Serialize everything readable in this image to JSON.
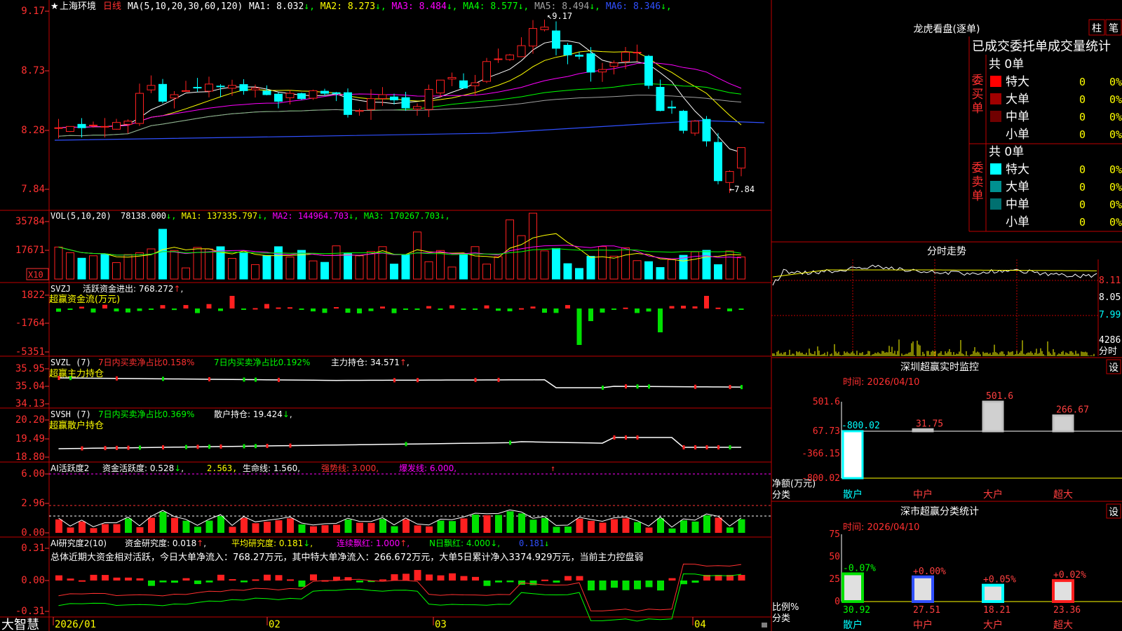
{
  "colors": {
    "up": "#ff2020",
    "down": "#00ffff",
    "green": "#00e000",
    "yellow": "#ffff00",
    "magenta": "#ff00ff",
    "white": "#ffffff",
    "blue": "#3050ff",
    "grid_red": "#c00000",
    "axis_red": "#ff3030",
    "gray": "#a0a0a0"
  },
  "footer": {
    "brand": "大智慧",
    "dates": [
      "2026/01",
      "02",
      "03",
      "04"
    ]
  },
  "kline": {
    "star": "★",
    "name": "上海环境",
    "period": "日线",
    "ma_header": "MA(5,10,20,30,60,120)",
    "ma_items": [
      {
        "label": "MA1:",
        "value": "8.032",
        "color": "#ffffff"
      },
      {
        "label": "MA2:",
        "value": "8.273",
        "color": "#ffff00"
      },
      {
        "label": "MA3:",
        "value": "8.484",
        "color": "#ff00ff"
      },
      {
        "label": "MA4:",
        "value": "8.577",
        "color": "#00ff00"
      },
      {
        "label": "MA5:",
        "value": "8.494",
        "color": "#a0a0a0"
      },
      {
        "label": "MA6:",
        "value": "8.346",
        "color": "#3050ff"
      }
    ],
    "y_labels": [
      "9.17",
      "8.73",
      "8.28",
      "7.84"
    ],
    "high_label": "9.17",
    "low_label": "←7.84"
  },
  "vol": {
    "title": "VOL(5,10,20)",
    "items": [
      {
        "label": "",
        "value": "78138.000",
        "color": "#ffffff"
      },
      {
        "label": "MA1:",
        "value": "137335.797",
        "color": "#ffff00"
      },
      {
        "label": "MA2:",
        "value": "144964.703",
        "color": "#ff00ff"
      },
      {
        "label": "MA3:",
        "value": "170267.703",
        "color": "#00ff00"
      }
    ],
    "y_labels": [
      "35784",
      "17671"
    ],
    "unit": "X10"
  },
  "svzj": {
    "title": "SVZJ",
    "line1": "活跃资金进出: 768.272",
    "line2": "超赢资金流(万元)",
    "y_labels": [
      "1822",
      "-1764",
      "-5351"
    ]
  },
  "svzl": {
    "title": "SVZL (7)",
    "label_red": "7日内买卖净占比0.158%",
    "label_green": "7日内买卖净占比0.192%",
    "label_white": "主力持仓: 34.571",
    "line2": "超赢主力持仓",
    "y_labels": [
      "35.95",
      "35.04",
      "34.13"
    ]
  },
  "svsh": {
    "title": "SVSH (7)",
    "label_green": "7日内买卖净占比0.369%",
    "label_white": "散户持仓: 19.424",
    "line2": "超赢散户持仓",
    "y_labels": [
      "20.20",
      "19.49",
      "18.80"
    ]
  },
  "ai1": {
    "title": "AI活跃度2",
    "label1": "资金活跃度: 0.528",
    "label2": "2.563,",
    "label3": "生命线: 1.560,",
    "label4": "强势线: 3.000,",
    "label5": "爆发线: 6.000,",
    "y_labels": [
      "6.00",
      "2.96",
      "0.00"
    ]
  },
  "ai2": {
    "title": "AI研究度2(10)",
    "label1": "资金研究度: 0.018",
    "label2": "平均研究度: 0.181",
    "label3": "连续飘红: 1.000",
    "label4": "N日飘红: 4.000",
    "label5": "0.181",
    "summary": "总体近期大资金相对活跃，今日大单净流入：768.27万元，其中特大单净流入：266.672万元，大单5日累计净入3374.929万元，当前主力控盘弱",
    "y_labels": [
      "0.31",
      "0.00",
      "-0.31"
    ]
  },
  "dragon": {
    "title": "龙虎看盘(逐单)",
    "btn1": "柱",
    "btn2": "笔",
    "subtitle": "已成交委托单成交量统计",
    "buy_label": "委买单",
    "sell_label": "委卖单",
    "buy_total": "共 0单",
    "sell_total": "共 0单",
    "buy_rows": [
      {
        "name": "特大",
        "count": "0",
        "pct": "0%",
        "color": "#ff0000"
      },
      {
        "name": "大单",
        "count": "0",
        "pct": "0%",
        "color": "#a00000"
      },
      {
        "name": "中单",
        "count": "0",
        "pct": "0%",
        "color": "#700000"
      },
      {
        "name": "小单",
        "count": "0",
        "pct": "0%",
        "color": ""
      }
    ],
    "sell_rows": [
      {
        "name": "特大",
        "count": "0",
        "pct": "0%",
        "color": "#00ffff"
      },
      {
        "name": "大单",
        "count": "0",
        "pct": "0%",
        "color": "#009090"
      },
      {
        "name": "中单",
        "count": "0",
        "pct": "0%",
        "color": "#007070"
      },
      {
        "name": "小单",
        "count": "0",
        "pct": "0%",
        "color": ""
      }
    ]
  },
  "intraday": {
    "title": "分时走势",
    "price_labels": [
      "8.11",
      "8.05",
      "7.99"
    ],
    "vol_label": "4286",
    "unit_label": "分时"
  },
  "shenzhen_monitor": {
    "title": "深圳超赢实时监控",
    "btn": "设",
    "time": "时间: 2026/04/10",
    "y_labels": [
      "501.6",
      "67.73",
      "-366.15",
      "-800.02"
    ],
    "axis_title1": "净额(万元)",
    "axis_title2": "分类",
    "bars": [
      {
        "name": "散户",
        "value": -800.02,
        "label": "-800.02",
        "name_color": "#00ffff"
      },
      {
        "name": "中户",
        "value": 31.75,
        "label": "31.75",
        "name_color": "#ff4040"
      },
      {
        "name": "大户",
        "value": 501.6,
        "label": "501.6",
        "name_color": "#ff4040"
      },
      {
        "name": "超大",
        "value": 266.67,
        "label": "266.67",
        "name_color": "#ff4040"
      }
    ]
  },
  "shenzhen_class": {
    "title": "深市超赢分类统计",
    "btn": "设",
    "time": "时间: 2026/04/10",
    "y_labels": [
      "75",
      "50",
      "25",
      "0"
    ],
    "axis_title1": "比例%",
    "axis_title2": "分类",
    "bars": [
      {
        "name": "散户",
        "value": 30.92,
        "label": "30.92",
        "change": "-0.07%",
        "change_color": "#00ff00",
        "name_color": "#00ffff"
      },
      {
        "name": "中户",
        "value": 27.51,
        "label": "27.51",
        "change": "+0.00%",
        "change_color": "#ff4040",
        "name_color": "#ff4040"
      },
      {
        "name": "大户",
        "value": 18.21,
        "label": "18.21",
        "change": "+0.05%",
        "change_color": "#ff4040",
        "name_color": "#ff4040"
      },
      {
        "name": "超大",
        "value": 23.36,
        "label": "23.36",
        "change": "+0.02%",
        "change_color": "#ff4040",
        "name_color": "#ff4040"
      }
    ]
  }
}
